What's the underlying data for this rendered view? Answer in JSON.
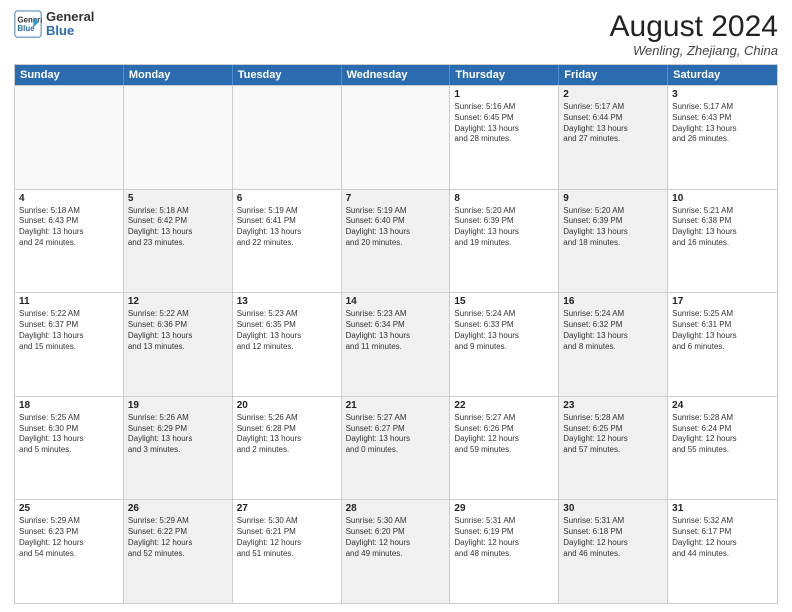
{
  "logo": {
    "line1": "General",
    "line2": "Blue"
  },
  "title": "August 2024",
  "location": "Wenling, Zhejiang, China",
  "weekdays": [
    "Sunday",
    "Monday",
    "Tuesday",
    "Wednesday",
    "Thursday",
    "Friday",
    "Saturday"
  ],
  "rows": [
    [
      {
        "day": "",
        "info": "",
        "shaded": false,
        "empty": true
      },
      {
        "day": "",
        "info": "",
        "shaded": true,
        "empty": true
      },
      {
        "day": "",
        "info": "",
        "shaded": false,
        "empty": true
      },
      {
        "day": "",
        "info": "",
        "shaded": true,
        "empty": true
      },
      {
        "day": "1",
        "info": "Sunrise: 5:16 AM\nSunset: 6:45 PM\nDaylight: 13 hours\nand 28 minutes.",
        "shaded": false,
        "empty": false
      },
      {
        "day": "2",
        "info": "Sunrise: 5:17 AM\nSunset: 6:44 PM\nDaylight: 13 hours\nand 27 minutes.",
        "shaded": true,
        "empty": false
      },
      {
        "day": "3",
        "info": "Sunrise: 5:17 AM\nSunset: 6:43 PM\nDaylight: 13 hours\nand 26 minutes.",
        "shaded": false,
        "empty": false
      }
    ],
    [
      {
        "day": "4",
        "info": "Sunrise: 5:18 AM\nSunset: 6:43 PM\nDaylight: 13 hours\nand 24 minutes.",
        "shaded": false,
        "empty": false
      },
      {
        "day": "5",
        "info": "Sunrise: 5:18 AM\nSunset: 6:42 PM\nDaylight: 13 hours\nand 23 minutes.",
        "shaded": true,
        "empty": false
      },
      {
        "day": "6",
        "info": "Sunrise: 5:19 AM\nSunset: 6:41 PM\nDaylight: 13 hours\nand 22 minutes.",
        "shaded": false,
        "empty": false
      },
      {
        "day": "7",
        "info": "Sunrise: 5:19 AM\nSunset: 6:40 PM\nDaylight: 13 hours\nand 20 minutes.",
        "shaded": true,
        "empty": false
      },
      {
        "day": "8",
        "info": "Sunrise: 5:20 AM\nSunset: 6:39 PM\nDaylight: 13 hours\nand 19 minutes.",
        "shaded": false,
        "empty": false
      },
      {
        "day": "9",
        "info": "Sunrise: 5:20 AM\nSunset: 6:39 PM\nDaylight: 13 hours\nand 18 minutes.",
        "shaded": true,
        "empty": false
      },
      {
        "day": "10",
        "info": "Sunrise: 5:21 AM\nSunset: 6:38 PM\nDaylight: 13 hours\nand 16 minutes.",
        "shaded": false,
        "empty": false
      }
    ],
    [
      {
        "day": "11",
        "info": "Sunrise: 5:22 AM\nSunset: 6:37 PM\nDaylight: 13 hours\nand 15 minutes.",
        "shaded": false,
        "empty": false
      },
      {
        "day": "12",
        "info": "Sunrise: 5:22 AM\nSunset: 6:36 PM\nDaylight: 13 hours\nand 13 minutes.",
        "shaded": true,
        "empty": false
      },
      {
        "day": "13",
        "info": "Sunrise: 5:23 AM\nSunset: 6:35 PM\nDaylight: 13 hours\nand 12 minutes.",
        "shaded": false,
        "empty": false
      },
      {
        "day": "14",
        "info": "Sunrise: 5:23 AM\nSunset: 6:34 PM\nDaylight: 13 hours\nand 11 minutes.",
        "shaded": true,
        "empty": false
      },
      {
        "day": "15",
        "info": "Sunrise: 5:24 AM\nSunset: 6:33 PM\nDaylight: 13 hours\nand 9 minutes.",
        "shaded": false,
        "empty": false
      },
      {
        "day": "16",
        "info": "Sunrise: 5:24 AM\nSunset: 6:32 PM\nDaylight: 13 hours\nand 8 minutes.",
        "shaded": true,
        "empty": false
      },
      {
        "day": "17",
        "info": "Sunrise: 5:25 AM\nSunset: 6:31 PM\nDaylight: 13 hours\nand 6 minutes.",
        "shaded": false,
        "empty": false
      }
    ],
    [
      {
        "day": "18",
        "info": "Sunrise: 5:25 AM\nSunset: 6:30 PM\nDaylight: 13 hours\nand 5 minutes.",
        "shaded": false,
        "empty": false
      },
      {
        "day": "19",
        "info": "Sunrise: 5:26 AM\nSunset: 6:29 PM\nDaylight: 13 hours\nand 3 minutes.",
        "shaded": true,
        "empty": false
      },
      {
        "day": "20",
        "info": "Sunrise: 5:26 AM\nSunset: 6:28 PM\nDaylight: 13 hours\nand 2 minutes.",
        "shaded": false,
        "empty": false
      },
      {
        "day": "21",
        "info": "Sunrise: 5:27 AM\nSunset: 6:27 PM\nDaylight: 13 hours\nand 0 minutes.",
        "shaded": true,
        "empty": false
      },
      {
        "day": "22",
        "info": "Sunrise: 5:27 AM\nSunset: 6:26 PM\nDaylight: 12 hours\nand 59 minutes.",
        "shaded": false,
        "empty": false
      },
      {
        "day": "23",
        "info": "Sunrise: 5:28 AM\nSunset: 6:25 PM\nDaylight: 12 hours\nand 57 minutes.",
        "shaded": true,
        "empty": false
      },
      {
        "day": "24",
        "info": "Sunrise: 5:28 AM\nSunset: 6:24 PM\nDaylight: 12 hours\nand 55 minutes.",
        "shaded": false,
        "empty": false
      }
    ],
    [
      {
        "day": "25",
        "info": "Sunrise: 5:29 AM\nSunset: 6:23 PM\nDaylight: 12 hours\nand 54 minutes.",
        "shaded": false,
        "empty": false
      },
      {
        "day": "26",
        "info": "Sunrise: 5:29 AM\nSunset: 6:22 PM\nDaylight: 12 hours\nand 52 minutes.",
        "shaded": true,
        "empty": false
      },
      {
        "day": "27",
        "info": "Sunrise: 5:30 AM\nSunset: 6:21 PM\nDaylight: 12 hours\nand 51 minutes.",
        "shaded": false,
        "empty": false
      },
      {
        "day": "28",
        "info": "Sunrise: 5:30 AM\nSunset: 6:20 PM\nDaylight: 12 hours\nand 49 minutes.",
        "shaded": true,
        "empty": false
      },
      {
        "day": "29",
        "info": "Sunrise: 5:31 AM\nSunset: 6:19 PM\nDaylight: 12 hours\nand 48 minutes.",
        "shaded": false,
        "empty": false
      },
      {
        "day": "30",
        "info": "Sunrise: 5:31 AM\nSunset: 6:18 PM\nDaylight: 12 hours\nand 46 minutes.",
        "shaded": true,
        "empty": false
      },
      {
        "day": "31",
        "info": "Sunrise: 5:32 AM\nSunset: 6:17 PM\nDaylight: 12 hours\nand 44 minutes.",
        "shaded": false,
        "empty": false
      }
    ]
  ]
}
